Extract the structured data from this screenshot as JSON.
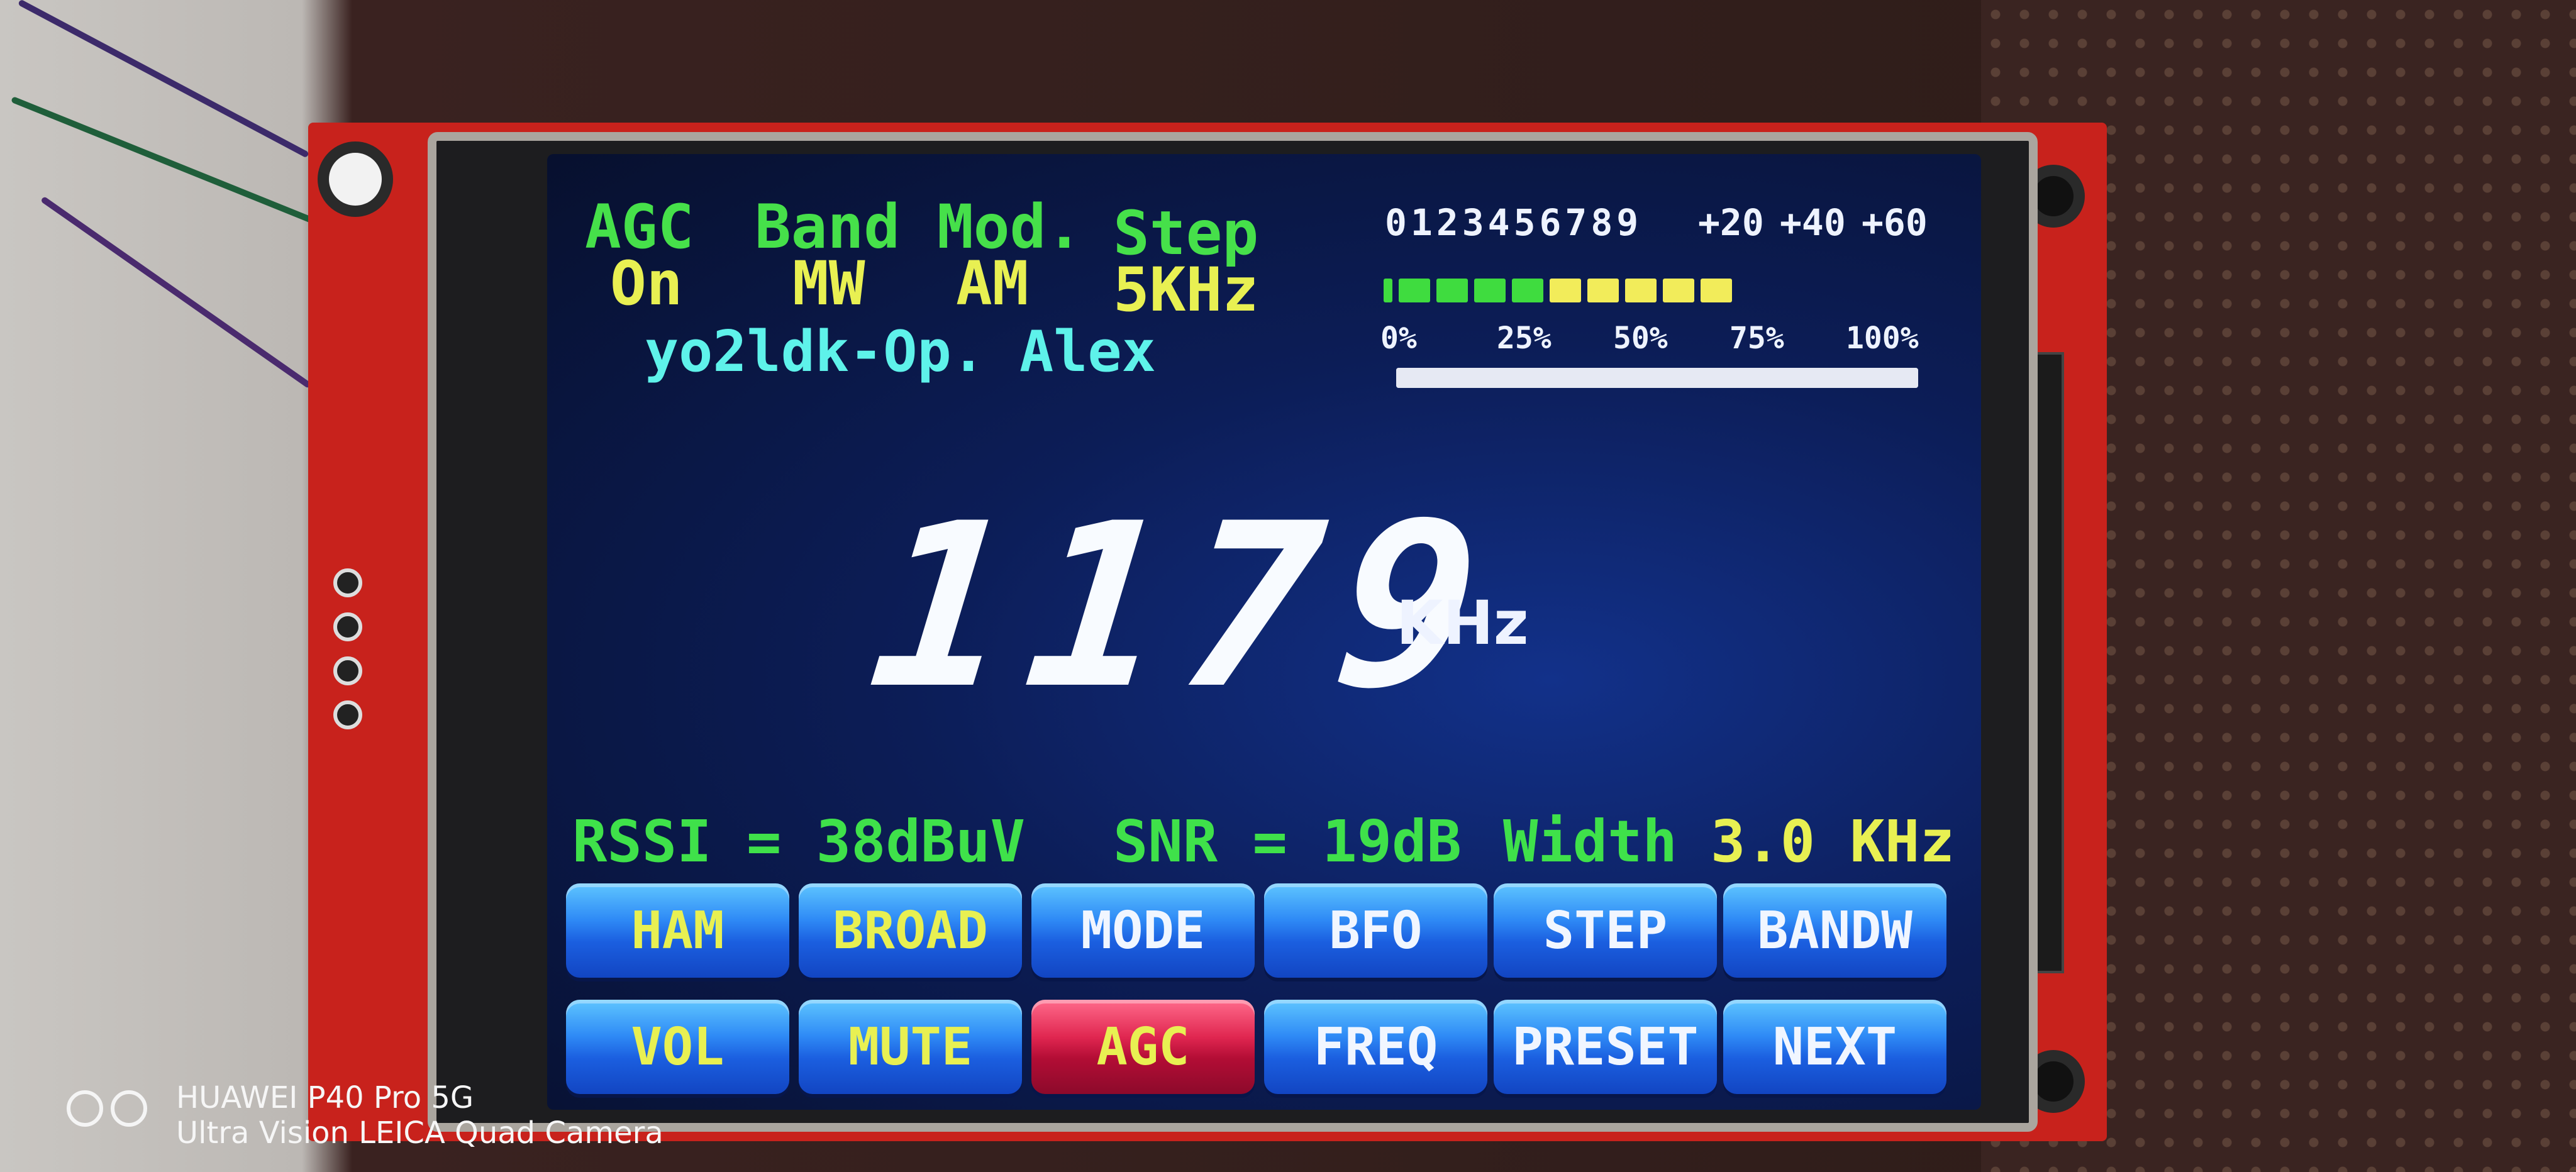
{
  "header": {
    "agc": {
      "label": "AGC",
      "value": "On"
    },
    "band": {
      "label": "Band",
      "value": "MW"
    },
    "mod": {
      "label": "Mod.",
      "value": "AM"
    },
    "step": {
      "label": "Step",
      "value": "5KHz"
    },
    "station": "yo2ldk-Op. Alex"
  },
  "signal_meter": {
    "scale_digits": "0123456789",
    "scale_plus": [
      "+20",
      "+40",
      "+60"
    ],
    "level_segments_green": 5,
    "level_segments_yellow": 5,
    "colors": {
      "green": "#3fdc3f",
      "yellow": "#f2ec5a"
    }
  },
  "progress": {
    "ticks": [
      "0%",
      "25%",
      "50%",
      "75%",
      "100%"
    ],
    "value_fraction": 1.0
  },
  "frequency": {
    "value": "1179",
    "unit": "KHz"
  },
  "status": {
    "rssi": "RSSI = 38dBuV",
    "snr": "SNR = 19dB",
    "width_label": "Width",
    "width_value": "3.0 KHz"
  },
  "buttons": {
    "row1": [
      "HAM",
      "BROAD",
      "MODE",
      "BFO",
      "STEP",
      "BANDW"
    ],
    "row2": [
      "VOL",
      "MUTE",
      "AGC",
      "FREQ",
      "PRESET",
      "NEXT"
    ],
    "active": "AGC"
  },
  "camera_watermark": {
    "line1": "HUAWEI P40 Pro 5G",
    "line2": "Ultra Vision LEICA Quad Camera"
  },
  "colors": {
    "screen_bg": "#0c1d57",
    "label_green": "#46e04a",
    "value_yellow": "#e8f052",
    "station_cyan": "#5ef2ea",
    "button_blue": "#1b5fe0",
    "button_active_red": "#b30d35"
  }
}
